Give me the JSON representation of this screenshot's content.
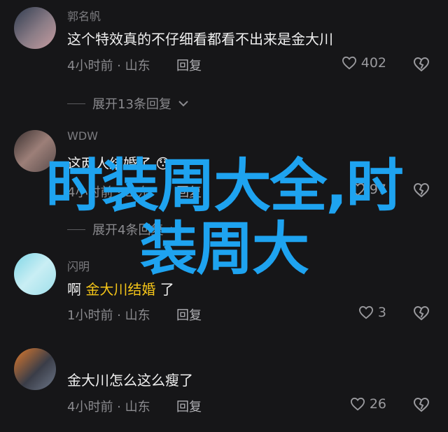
{
  "comments": [
    {
      "username": "郭名帆",
      "text": "这个特效真的不仔细看都看不出来是金大川",
      "meta": "4小时前 · 山东",
      "reply": "回复",
      "likes": "402"
    },
    {
      "username": "WDW",
      "text": "这两人结婚了",
      "emoji": "😯",
      "meta": "4小时前 · 山东",
      "reply": "回复",
      "likes": "97"
    },
    {
      "username": "闪明",
      "text_prefix": "啊",
      "mention": "金大川结婚",
      "text_suffix": "了",
      "meta": "1小时前 · 山东",
      "reply": "回复",
      "likes": "3"
    },
    {
      "username": "",
      "text": "金大川怎么这么瘦了",
      "meta": "4小时前 · 山东",
      "reply": "回复",
      "likes": "26"
    }
  ],
  "expand_replies": [
    {
      "label": "展开13条回复"
    },
    {
      "label": "展开4条回复"
    }
  ],
  "overlay": {
    "line1": "时装周大全,时",
    "line2": "装周大"
  },
  "icons": {
    "like": "heart-outline-icon",
    "dislike": "broken-heart-icon",
    "expand": "chevron-down-icon"
  },
  "colors": {
    "background": "#161618",
    "overlay_text": "#1ea3f0",
    "mention": "#f5c518"
  }
}
